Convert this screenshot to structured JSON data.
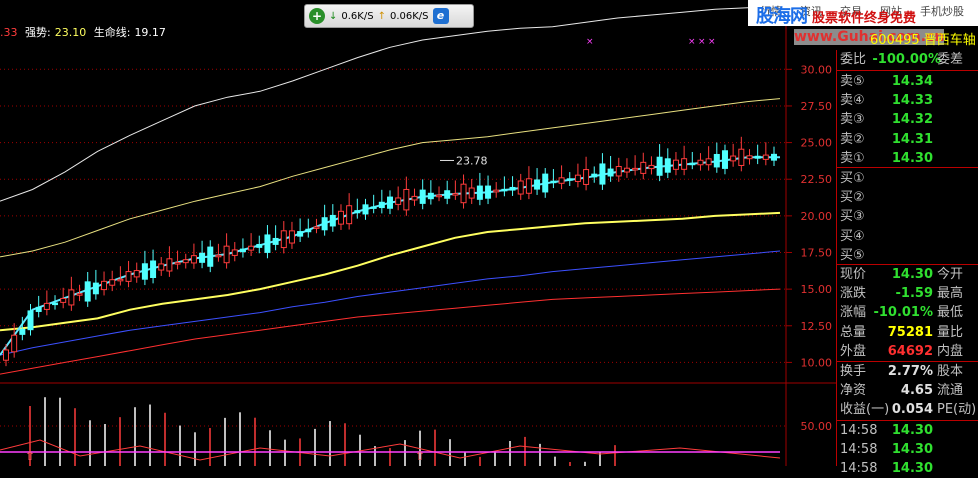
{
  "top_indicator": {
    "prefix": ".33",
    "label1": "强势:",
    "value1": "23.10",
    "label2": "生命线:",
    "value2": "19.17"
  },
  "speed_bar": {
    "down_text": "0.6K/S",
    "up_text": "0.06K/S",
    "plus_icon": "plus-icon",
    "browser_icon": "ie-icon"
  },
  "top_tabs": [
    "行情",
    "资讯",
    "交易",
    "网站",
    "手机炒股"
  ],
  "watermark": {
    "site": "股海网",
    "slogan": "股票软件终身免费",
    "url": "www.Guhai.com.cn"
  },
  "stock": {
    "code": "600495",
    "name": "晋西车轴"
  },
  "order_book": {
    "ratio_label": "委比",
    "ratio_value": "-100.00%",
    "diff_label": "委差",
    "sell": [
      {
        "label": "卖⑤",
        "price": "14.34"
      },
      {
        "label": "卖④",
        "price": "14.33"
      },
      {
        "label": "卖③",
        "price": "14.32"
      },
      {
        "label": "卖②",
        "price": "14.31"
      },
      {
        "label": "卖①",
        "price": "14.30"
      }
    ],
    "buy": [
      {
        "label": "买①",
        "price": ""
      },
      {
        "label": "买②",
        "price": ""
      },
      {
        "label": "买③",
        "price": ""
      },
      {
        "label": "买④",
        "price": ""
      },
      {
        "label": "买⑤",
        "price": ""
      }
    ]
  },
  "quote": [
    {
      "label": "现价",
      "value": "14.30",
      "label2": "今开",
      "color": "#30e030"
    },
    {
      "label": "涨跌",
      "value": "-1.59",
      "label2": "最高",
      "color": "#30e030"
    },
    {
      "label": "涨幅",
      "value": "-10.01%",
      "label2": "最低",
      "color": "#30e030"
    },
    {
      "label": "总量",
      "value": "75281",
      "label2": "量比",
      "color": "#ffff00"
    },
    {
      "label": "外盘",
      "value": "64692",
      "label2": "内盘",
      "color": "#ff3030"
    }
  ],
  "fundamentals": [
    {
      "label": "换手",
      "value": "2.77%",
      "label2": "股本",
      "color": "#e0e0e0"
    },
    {
      "label": "净资",
      "value": "4.65",
      "label2": "流通",
      "color": "#e0e0e0"
    },
    {
      "label": "收益(一)",
      "value": "0.054",
      "label2": "PE(动)",
      "color": "#e0e0e0"
    }
  ],
  "ticks": [
    {
      "time": "14:58",
      "price": "14.30"
    },
    {
      "time": "14:58",
      "price": "14.30"
    },
    {
      "time": "14:58",
      "price": "14.30"
    }
  ],
  "price_axis": [
    "30.00",
    "27.50",
    "25.00",
    "22.50",
    "20.00",
    "17.50",
    "15.00",
    "12.50",
    "10.00"
  ],
  "volume_axis": [
    "50.00"
  ],
  "peak_label": "23.78",
  "colors": {
    "up": "#ff3c3c",
    "down": "#50ffff",
    "ma_yellow": "#ffff60",
    "ma_cyan": "#60e8ff",
    "bb_outer": "#e8e8e8",
    "bb_mid": "#e8e080",
    "ma_blue": "#3c50ff",
    "ma_red": "#ff3030",
    "grid": "#a00000"
  },
  "chart_data": {
    "type": "candlestick",
    "ylim": [
      8.8,
      32.0
    ],
    "ma_cyan": [
      10.5,
      13.6,
      14.4,
      15.2,
      16.0,
      16.6,
      17.1,
      17.4,
      18.0,
      18.6,
      19.5,
      20.3,
      20.9,
      21.3,
      21.5,
      21.6,
      21.9,
      22.3,
      22.6,
      23.0,
      23.3,
      23.5,
      23.7,
      24.0,
      24.0
    ],
    "ma_yellow": [
      12.2,
      12.4,
      12.7,
      13.0,
      13.6,
      14.0,
      14.3,
      14.6,
      15.0,
      15.5,
      16.0,
      16.6,
      17.3,
      17.9,
      18.5,
      18.9,
      19.1,
      19.3,
      19.5,
      19.6,
      19.7,
      19.8,
      20.0,
      20.1,
      20.2
    ],
    "ma_blue": [
      10.5,
      11.0,
      11.4,
      11.8,
      12.2,
      12.5,
      12.8,
      13.1,
      13.4,
      13.8,
      14.1,
      14.5,
      14.8,
      15.1,
      15.4,
      15.7,
      15.9,
      16.2,
      16.4,
      16.6,
      16.8,
      17.0,
      17.2,
      17.4,
      17.6
    ],
    "ma_red": [
      9.2,
      9.6,
      10.0,
      10.4,
      10.8,
      11.2,
      11.6,
      11.9,
      12.2,
      12.5,
      12.8,
      13.1,
      13.3,
      13.5,
      13.7,
      13.9,
      14.1,
      14.3,
      14.4,
      14.5,
      14.6,
      14.7,
      14.8,
      14.9,
      15.0
    ],
    "bb_upper": [
      21.0,
      21.8,
      23.0,
      24.4,
      25.5,
      26.5,
      27.5,
      28.1,
      28.5,
      29.2,
      30.0,
      30.8,
      31.5,
      32.0,
      32.3,
      32.6,
      32.8,
      32.9,
      33.2,
      33.5,
      33.7,
      33.9,
      34.1,
      34.2,
      34.3
    ],
    "bb_mid": [
      17.2,
      17.6,
      18.2,
      19.0,
      19.8,
      20.4,
      21.0,
      21.5,
      22.0,
      22.7,
      23.3,
      23.9,
      24.5,
      25.0,
      25.2,
      25.4,
      25.7,
      26.0,
      26.3,
      26.6,
      26.9,
      27.2,
      27.5,
      27.8,
      28.0
    ],
    "candles_summary": "red/cyan alternating candles tracking the cyan line",
    "peak_value": 23.78
  }
}
